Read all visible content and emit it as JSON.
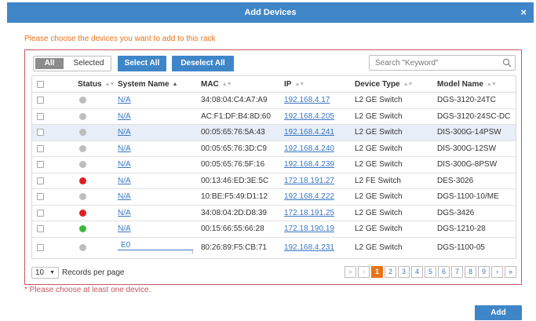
{
  "dialog": {
    "title": "Add Devices",
    "close_glyph": "×"
  },
  "instruction": "Please choose the devices you want to add to this rack",
  "filter": {
    "all_label": "All",
    "selected_label": "Selected"
  },
  "actions": {
    "select_all": "Select All",
    "deselect_all": "Deselect All"
  },
  "search": {
    "placeholder": "Search \"Keyword\"",
    "icon": "search-icon"
  },
  "table": {
    "headers": {
      "status": "Status",
      "name": "System Name",
      "mac": "MAC",
      "ip": "IP",
      "type": "Device Type",
      "model": "Model Name"
    },
    "rows": [
      {
        "status_color": "#bdbdbd",
        "name": "N/A",
        "mac": "34:08:04:C4:A7:A9",
        "ip": "192.168.4.17",
        "type": "L2 GE Switch",
        "model": "DGS-3120-24TC"
      },
      {
        "status_color": "#bdbdbd",
        "name": "N/A",
        "mac": "AC:F1:DF:B4:8D:60",
        "ip": "192.168.4.205",
        "type": "L2 GE Switch",
        "model": "DGS-3120-24SC-DC"
      },
      {
        "status_color": "#bdbdbd",
        "name": "N/A",
        "mac": "00:05:65:76:5A:43",
        "ip": "192.168.4.241",
        "type": "L2 GE Switch",
        "model": "DIS-300G-14PSW",
        "highlight": true
      },
      {
        "status_color": "#bdbdbd",
        "name": "N/A",
        "mac": "00:05:65:76:3D:C9",
        "ip": "192.168.4.240",
        "type": "L2 GE Switch",
        "model": "DIS-300G-12SW"
      },
      {
        "status_color": "#bdbdbd",
        "name": "N/A",
        "mac": "00:05:65:76:5F:16",
        "ip": "192.168.4.239",
        "type": "L2 GE Switch",
        "model": "DIS-300G-8PSW"
      },
      {
        "status_color": "#e02020",
        "name": "N/A",
        "mac": "00:13:46:ED:3E:5C",
        "ip": "172.18.191.27",
        "type": "L2 FE Switch",
        "model": "DES-3026"
      },
      {
        "status_color": "#bdbdbd",
        "name": "N/A",
        "mac": "10:BE:F5:49:D1:12",
        "ip": "192.168.4.222",
        "type": "L2 GE Switch",
        "model": "DGS-1100-10/ME"
      },
      {
        "status_color": "#e02020",
        "name": "N/A",
        "mac": "34:08:04:2D:D8:39",
        "ip": "172.18.191.25",
        "type": "L2 GE Switch",
        "model": "DGS-3426"
      },
      {
        "status_color": "#3db83d",
        "name": "N/A",
        "mac": "00:15:66:55:66:28",
        "ip": "172.18.190.19",
        "type": "L2 GE Switch",
        "model": "DGS-1210-28"
      },
      {
        "status_color": "#bdbdbd",
        "name": "E0",
        "mac": "80:26:89:F5:CB:71",
        "ip": "192.168.4.231",
        "type": "L2 GE Switch",
        "model": "DGS-1100-05",
        "editing": true
      }
    ]
  },
  "paging": {
    "per_page_value": "10",
    "per_page_label": "Records per page",
    "first": "«",
    "prev": "‹",
    "next": "›",
    "last": "»",
    "pages": [
      "1",
      "2",
      "3",
      "4",
      "5",
      "6",
      "7",
      "8",
      "9"
    ],
    "current": "1"
  },
  "hint": "* Please choose at least one device.",
  "add_button": "Add",
  "colors": {
    "header_blue": "#3f86c8",
    "accent_orange": "#e8731a",
    "error_red": "#c9565b",
    "link_blue": "#3a77c3"
  }
}
